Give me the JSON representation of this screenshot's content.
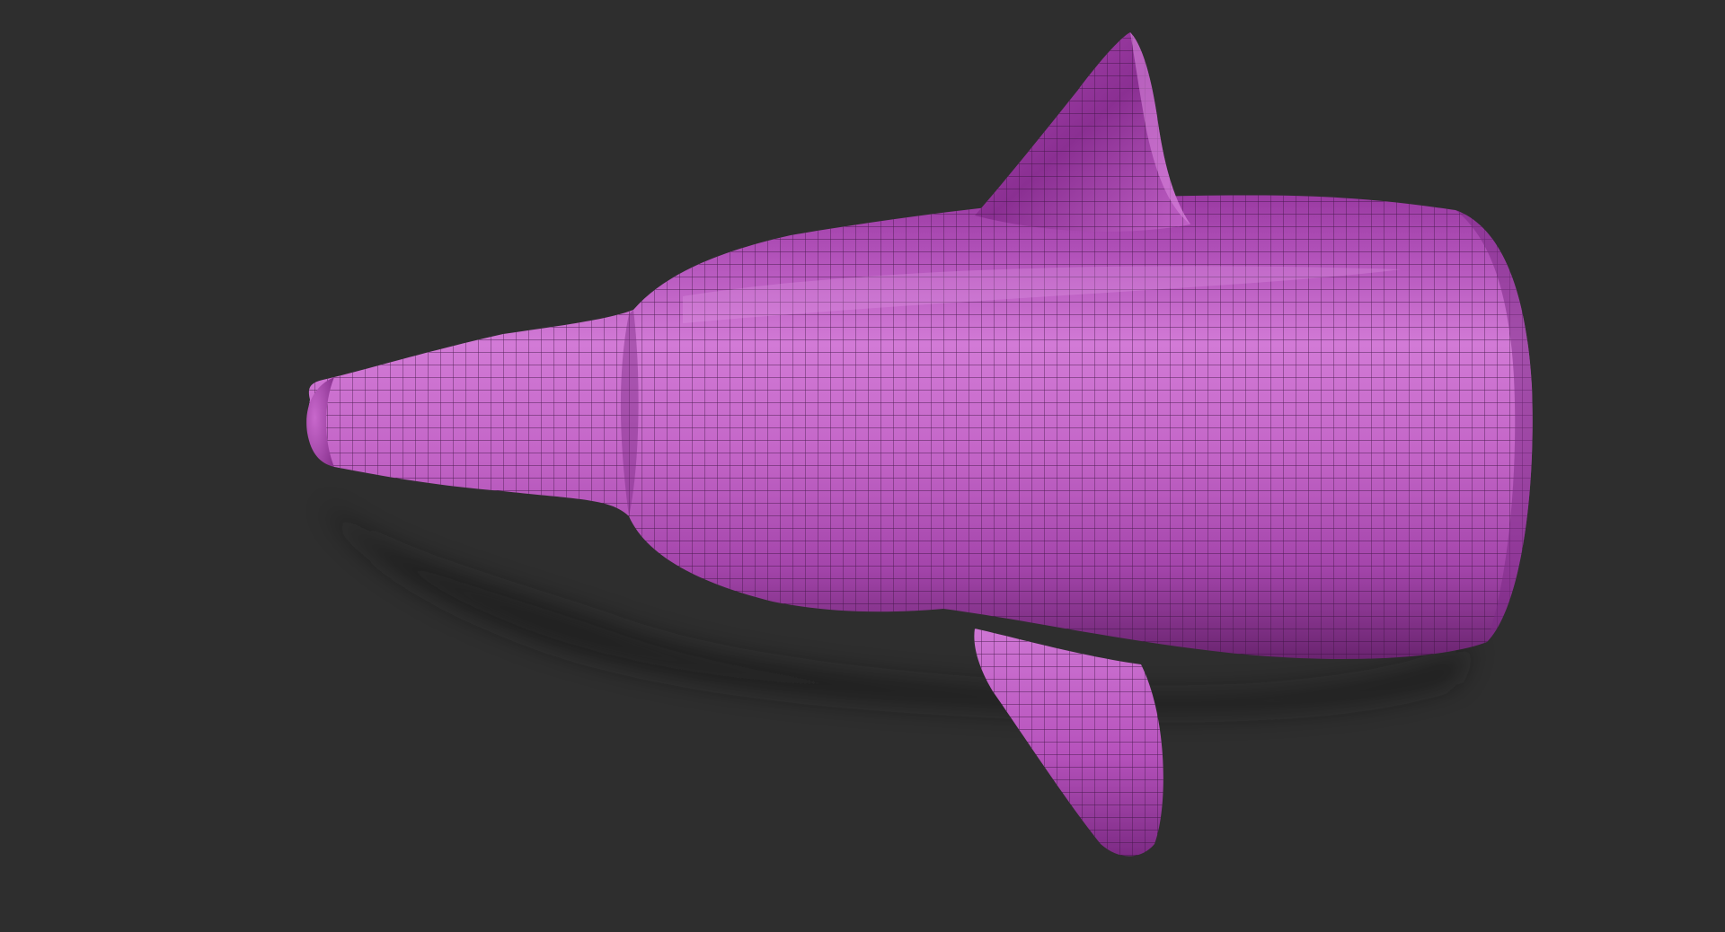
{
  "viewport": {
    "background_color": "#2e2e2e",
    "mesh": {
      "name": "sculpt-mesh",
      "material_color": "#c060c8",
      "highlight_color": "#da82de",
      "shadow_color": "#5a1c60",
      "wireframe_color": "#3a1440",
      "wireframe_visible": true
    }
  }
}
